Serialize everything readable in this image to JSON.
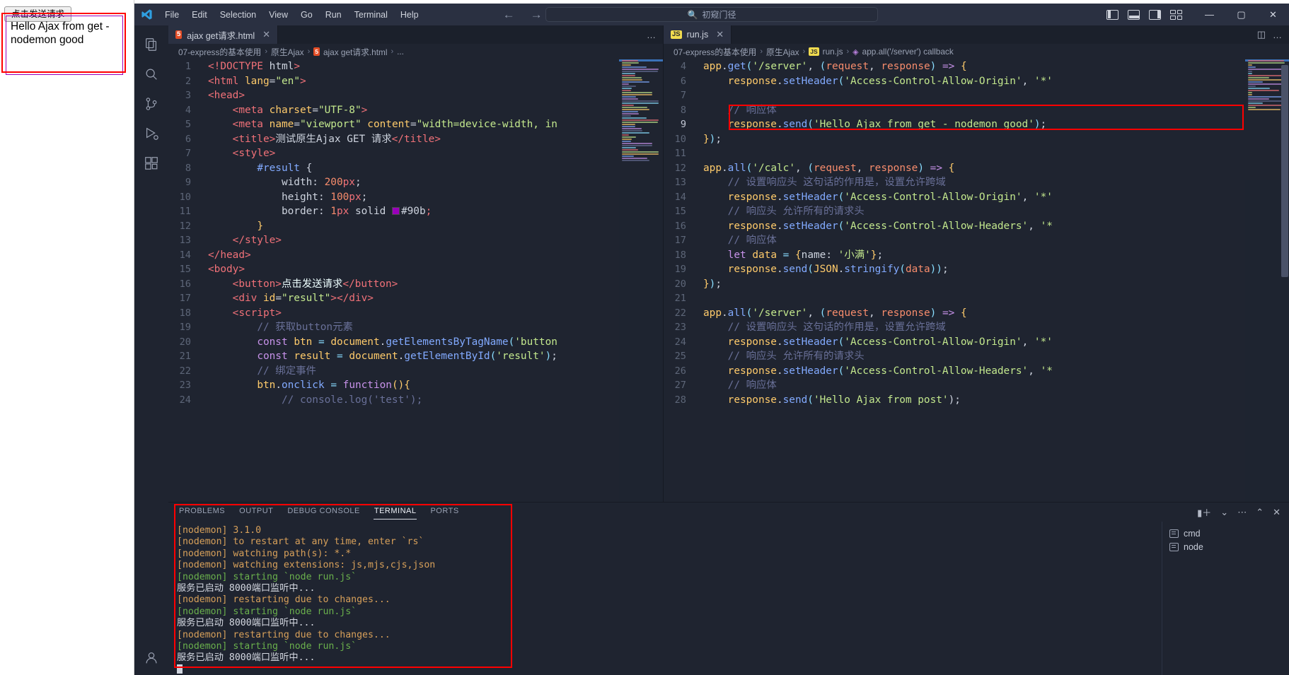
{
  "browser": {
    "button_label": "点击发送请求",
    "result_text": "Hello Ajax from get - nodemon good"
  },
  "titlebar": {
    "menus": [
      "File",
      "Edit",
      "Selection",
      "View",
      "Go",
      "Run",
      "Terminal",
      "Help"
    ],
    "search_placeholder": "初窥门径",
    "search_icon": "search-icon",
    "back_arrow": "←",
    "forward_arrow": "→",
    "minimize": "—",
    "maximize": "▢",
    "close": "✕"
  },
  "activitybar": {
    "items": [
      {
        "name": "explorer",
        "icon": "files-icon"
      },
      {
        "name": "search",
        "icon": "search-icon"
      },
      {
        "name": "source-control",
        "icon": "source-control-icon"
      },
      {
        "name": "run-and-debug",
        "icon": "run-debug-icon"
      },
      {
        "name": "extensions",
        "icon": "extensions-icon"
      },
      {
        "name": "accounts",
        "icon": "account-icon"
      }
    ]
  },
  "editor_left": {
    "tab": {
      "label": "ajax get请求.html",
      "icon": "html5-icon",
      "close": "✕"
    },
    "tab_actions": [
      "…"
    ],
    "breadcrumb": [
      "07-express的基本使用",
      "原生Ajax",
      "ajax get请求.html",
      "..."
    ],
    "lines": [
      {
        "n": "1",
        "html": "<span class='t-tag'>&lt;!DOCTYPE</span> <span class='t-plain'>html</span><span class='t-tag'>&gt;</span>"
      },
      {
        "n": "2",
        "html": "<span class='t-tag'>&lt;html</span> <span class='t-attr'>lang</span><span class='t-plain'>=</span><span class='t-str'>\"en\"</span><span class='t-tag'>&gt;</span>"
      },
      {
        "n": "3",
        "html": "<span class='t-tag'>&lt;head&gt;</span>"
      },
      {
        "n": "4",
        "html": "    <span class='t-tag'>&lt;meta</span> <span class='t-attr'>charset</span><span class='t-plain'>=</span><span class='t-str'>\"UTF-8\"</span><span class='t-tag'>&gt;</span>"
      },
      {
        "n": "5",
        "html": "    <span class='t-tag'>&lt;meta</span> <span class='t-attr'>name</span><span class='t-plain'>=</span><span class='t-str'>\"viewport\"</span> <span class='t-attr'>content</span><span class='t-plain'>=</span><span class='t-str'>\"width=device-width, in</span>"
      },
      {
        "n": "6",
        "html": "    <span class='t-tag'>&lt;title&gt;</span><span class='t-plain'>测试原生Ajax GET 请求</span><span class='t-tag'>&lt;/title&gt;</span>"
      },
      {
        "n": "7",
        "html": "    <span class='t-tag'>&lt;style&gt;</span>"
      },
      {
        "n": "8",
        "html": "        <span class='t-fn'>#result</span> <span class='t-plain'>{</span>"
      },
      {
        "n": "9",
        "html": "            <span class='t-plain'>width:</span> <span class='t-num'>200</span><span class='t-tag'>px</span><span class='t-plain'>;</span>"
      },
      {
        "n": "10",
        "html": "            <span class='t-plain'>height:</span> <span class='t-num'>100</span><span class='t-tag'>px</span><span class='t-plain'>;</span>"
      },
      {
        "n": "11",
        "html": "            <span class='t-plain'>border:</span> <span class='t-num'>1</span><span class='t-tag'>px</span> <span class='t-plain'>solid</span> <span class='colorbox'></span><span class='t-plain'>#90b</span><span class='t-tag'>;</span>"
      },
      {
        "n": "12",
        "html": "        <span class='t-attr'>}</span>"
      },
      {
        "n": "13",
        "html": "    <span class='t-tag'>&lt;/style&gt;</span>"
      },
      {
        "n": "14",
        "html": "<span class='t-tag'>&lt;/head&gt;</span>"
      },
      {
        "n": "15",
        "html": "<span class='t-tag'>&lt;body&gt;</span>"
      },
      {
        "n": "16",
        "html": "    <span class='t-tag'>&lt;button&gt;</span><span class='t-white'>点击发送请求</span><span class='t-tag'>&lt;/button&gt;</span>"
      },
      {
        "n": "17",
        "html": "    <span class='t-tag'>&lt;div</span> <span class='t-attr'>id</span><span class='t-plain'>=</span><span class='t-str'>\"result\"</span><span class='t-tag'>&gt;&lt;/div&gt;</span>"
      },
      {
        "n": "18",
        "html": "    <span class='t-tag'>&lt;script&gt;</span>"
      },
      {
        "n": "19",
        "html": "        <span class='t-cmt'>// 获取button元素</span>"
      },
      {
        "n": "20",
        "html": "        <span class='t-kw'>const</span> <span class='t-var'>btn</span> <span class='t-op'>=</span> <span class='t-var'>document</span><span class='t-plain'>.</span><span class='t-prop'>getElementsByTagName</span><span class='t-punc'>(</span><span class='t-str'>'button</span>"
      },
      {
        "n": "21",
        "html": "        <span class='t-kw'>const</span> <span class='t-var'>result</span> <span class='t-op'>=</span> <span class='t-var'>document</span><span class='t-plain'>.</span><span class='t-prop'>getElementById</span><span class='t-punc'>(</span><span class='t-str'>'result'</span><span class='t-punc'>)</span><span class='t-plain'>;</span>"
      },
      {
        "n": "22",
        "html": "        <span class='t-cmt'>// 绑定事件</span>"
      },
      {
        "n": "23",
        "html": "        <span class='t-var'>btn</span><span class='t-plain'>.</span><span class='t-prop'>onclick</span> <span class='t-op'>=</span> <span class='t-kw'>function</span><span class='t-attr'>()</span><span class='t-attr'>{</span>"
      },
      {
        "n": "24",
        "html": "            <span class='t-cmt'>// console.log('test');</span>"
      }
    ]
  },
  "editor_right": {
    "tab": {
      "label": "run.js",
      "icon": "js-icon",
      "close": "✕"
    },
    "tab_actions": [
      "split-editor-icon",
      "…"
    ],
    "breadcrumb": [
      "07-express的基本使用",
      "原生Ajax",
      "run.js",
      "app.all('/server') callback"
    ],
    "lines": [
      {
        "n": "4",
        "html": "<span class='t-var'>app</span><span class='t-plain'>.</span><span class='t-prop'>get</span><span class='t-punc'>(</span><span class='t-str'>'/server'</span><span class='t-plain'>,</span> <span class='t-punc'>(</span><span class='t-param'>request</span><span class='t-plain'>,</span> <span class='t-param'>response</span><span class='t-punc'>)</span> <span class='t-kw'>=&gt;</span> <span class='t-attr'>{</span>"
      },
      {
        "n": "6",
        "html": "    <span class='t-var'>response</span><span class='t-plain'>.</span><span class='t-prop'>setHeader</span><span class='t-punc'>(</span><span class='t-str'>'Access-Control-Allow-Origin'</span><span class='t-plain'>,</span> <span class='t-str'>'*'</span>"
      },
      {
        "n": "7",
        "html": ""
      },
      {
        "n": "8",
        "html": "    <span class='t-cmt'>// 响应体</span>"
      },
      {
        "n": "9",
        "html": "    <span class='t-var'>response</span><span class='t-plain'>.</span><span class='t-prop'>send</span><span class='t-punc'>(</span><span class='t-str'>'Hello Ajax from get - nodemon good'</span><span class='t-punc'>)</span><span class='t-plain'>;</span>"
      },
      {
        "n": "10",
        "html": "<span class='t-attr'>}</span><span class='t-punc'>)</span><span class='t-plain'>;</span>"
      },
      {
        "n": "11",
        "html": ""
      },
      {
        "n": "12",
        "html": "<span class='t-var'>app</span><span class='t-plain'>.</span><span class='t-prop'>all</span><span class='t-punc'>(</span><span class='t-str'>'/calc'</span><span class='t-plain'>,</span> <span class='t-punc'>(</span><span class='t-param'>request</span><span class='t-plain'>,</span> <span class='t-param'>response</span><span class='t-punc'>)</span> <span class='t-kw'>=&gt;</span> <span class='t-attr'>{</span>"
      },
      {
        "n": "13",
        "html": "    <span class='t-cmt'>// 设置响应头 这句话的作用是，设置允许跨域</span>"
      },
      {
        "n": "14",
        "html": "    <span class='t-var'>response</span><span class='t-plain'>.</span><span class='t-prop'>setHeader</span><span class='t-punc'>(</span><span class='t-str'>'Access-Control-Allow-Origin'</span><span class='t-plain'>,</span> <span class='t-str'>'*'</span>"
      },
      {
        "n": "15",
        "html": "    <span class='t-cmt'>// 响应头 允许所有的请求头</span>"
      },
      {
        "n": "16",
        "html": "    <span class='t-var'>response</span><span class='t-plain'>.</span><span class='t-prop'>setHeader</span><span class='t-punc'>(</span><span class='t-str'>'Access-Control-Allow-Headers'</span><span class='t-plain'>,</span> <span class='t-str'>'*</span>"
      },
      {
        "n": "17",
        "html": "    <span class='t-cmt'>// 响应体</span>"
      },
      {
        "n": "18",
        "html": "    <span class='t-kw'>let</span> <span class='t-var'>data</span> <span class='t-op'>=</span> <span class='t-attr'>{</span><span class='t-plain'>name:</span> <span class='t-str'>'小满'</span><span class='t-attr'>}</span><span class='t-plain'>;</span>"
      },
      {
        "n": "19",
        "html": "    <span class='t-var'>response</span><span class='t-plain'>.</span><span class='t-prop'>send</span><span class='t-punc'>(</span><span class='t-var'>JSON</span><span class='t-plain'>.</span><span class='t-prop'>stringify</span><span class='t-punc'>(</span><span class='t-param'>data</span><span class='t-punc'>))</span><span class='t-plain'>;</span>"
      },
      {
        "n": "20",
        "html": "<span class='t-attr'>}</span><span class='t-punc'>)</span><span class='t-plain'>;</span>"
      },
      {
        "n": "21",
        "html": ""
      },
      {
        "n": "22",
        "html": "<span class='t-var'>app</span><span class='t-plain'>.</span><span class='t-prop'>all</span><span class='t-punc'>(</span><span class='t-str'>'/server'</span><span class='t-plain'>,</span> <span class='t-punc'>(</span><span class='t-param'>request</span><span class='t-plain'>,</span> <span class='t-param'>response</span><span class='t-punc'>)</span> <span class='t-kw'>=&gt;</span> <span class='t-attr'>{</span>"
      },
      {
        "n": "23",
        "html": "    <span class='t-cmt'>// 设置响应头 这句话的作用是，设置允许跨域</span>"
      },
      {
        "n": "24",
        "html": "    <span class='t-var'>response</span><span class='t-plain'>.</span><span class='t-prop'>setHeader</span><span class='t-punc'>(</span><span class='t-str'>'Access-Control-Allow-Origin'</span><span class='t-plain'>,</span> <span class='t-str'>'*'</span>"
      },
      {
        "n": "25",
        "html": "    <span class='t-cmt'>// 响应头 允许所有的请求头</span>"
      },
      {
        "n": "26",
        "html": "    <span class='t-var'>response</span><span class='t-plain'>.</span><span class='t-prop'>setHeader</span><span class='t-punc'>(</span><span class='t-str'>'Access-Control-Allow-Headers'</span><span class='t-plain'>,</span> <span class='t-str'>'*</span>"
      },
      {
        "n": "27",
        "html": "    <span class='t-cmt'>// 响应体</span>"
      },
      {
        "n": "28",
        "html": "    <span class='t-var'>response</span><span class='t-plain'>.</span><span class='t-prop'>send</span><span class='t-punc'>(</span><span class='t-str'>'Hello Ajax from post'</span><span class='t-plain'>);</span>"
      }
    ],
    "highlight_line": "9"
  },
  "panel": {
    "tabs": [
      "PROBLEMS",
      "OUTPUT",
      "DEBUG CONSOLE",
      "TERMINAL",
      "PORTS"
    ],
    "active_tab": "TERMINAL",
    "actions": [
      "new-terminal-icon",
      "chevron-down-icon",
      "more-icon",
      "chevron-up-icon",
      "close-icon"
    ],
    "terminal_lines": [
      {
        "prefix": "[nodemon]",
        "text": " 3.1.0",
        "pcolor": "c-orange",
        "tcolor": "c-orange"
      },
      {
        "prefix": "[nodemon]",
        "text": " to restart at any time, enter `rs`",
        "pcolor": "c-orange",
        "tcolor": "c-orange"
      },
      {
        "prefix": "[nodemon]",
        "text": " watching path(s): *.*",
        "pcolor": "c-orange",
        "tcolor": "c-orange"
      },
      {
        "prefix": "[nodemon]",
        "text": " watching extensions: js,mjs,cjs,json",
        "pcolor": "c-orange",
        "tcolor": "c-orange"
      },
      {
        "prefix": "[nodemon]",
        "text": " starting `node run.js`",
        "pcolor": "c-green",
        "tcolor": "c-green"
      },
      {
        "prefix": "",
        "text": "服务已启动 8000端口监听中...",
        "pcolor": "c-white",
        "tcolor": "c-white"
      },
      {
        "prefix": "[nodemon]",
        "text": " restarting due to changes...",
        "pcolor": "c-orange",
        "tcolor": "c-orange"
      },
      {
        "prefix": "[nodemon]",
        "text": " starting `node run.js`",
        "pcolor": "c-green",
        "tcolor": "c-green"
      },
      {
        "prefix": "",
        "text": "服务已启动 8000端口监听中...",
        "pcolor": "c-white",
        "tcolor": "c-white"
      },
      {
        "prefix": "[nodemon]",
        "text": " restarting due to changes...",
        "pcolor": "c-orange",
        "tcolor": "c-orange"
      },
      {
        "prefix": "[nodemon]",
        "text": " starting `node run.js`",
        "pcolor": "c-green",
        "tcolor": "c-green"
      },
      {
        "prefix": "",
        "text": "服务已启动 8000端口监听中...",
        "pcolor": "c-white",
        "tcolor": "c-white"
      }
    ],
    "terminal_list": [
      "cmd",
      "node"
    ]
  },
  "colors": {
    "accent_red": "#ff0000",
    "editor_bg": "#1f2430",
    "titlebar_bg": "#2a3041",
    "purple_border": "#9900bb"
  }
}
